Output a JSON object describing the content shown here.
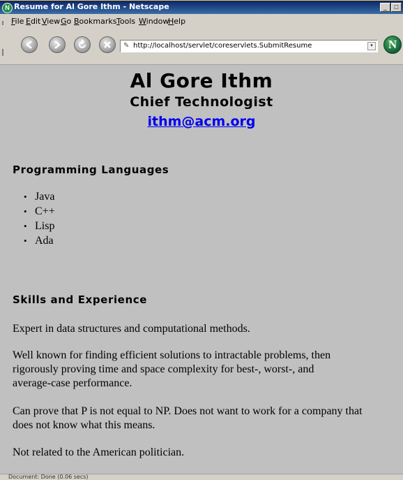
{
  "window": {
    "title": "Resume for Al Gore Ithm - Netscape",
    "app_icon_glyph": "N",
    "minimize_glyph": "_",
    "restore_glyph": "□"
  },
  "menubar": {
    "items": [
      "File",
      "Edit",
      "View",
      "Go",
      "Bookmarks",
      "Tools",
      "Window",
      "Help"
    ]
  },
  "navbar": {
    "buttons": [
      "back-icon",
      "forward-icon",
      "reload-icon",
      "stop-icon"
    ],
    "url": "http://localhost/servlet/coreservlets.SubmitResume",
    "dropdown_glyph": "▾",
    "throbber_glyph": "N"
  },
  "page": {
    "name": "Al Gore Ithm",
    "job_title": "Chief Technologist",
    "email": "ithm@acm.org",
    "sections": {
      "languages": {
        "heading": "Programming Languages",
        "items": [
          "Java",
          "C++",
          "Lisp",
          "Ada"
        ]
      },
      "skills": {
        "heading": "Skills and Experience",
        "paragraphs": [
          [
            "Expert in data structures and computational methods."
          ],
          [
            "Well known for finding efficient solutions to intractable problems, then",
            "rigorously proving time and space complexity for best-, worst-, and",
            "average-case performance."
          ],
          [
            "Can prove that P is not equal to NP. Does not want to work for a company that",
            "does not know what this means."
          ],
          [
            "Not related to the American politician."
          ]
        ]
      }
    }
  },
  "statusbar": {
    "text": "Document: Done (0.06 secs)"
  },
  "colors": {
    "page_background": "#c0c0c0",
    "link": "#0000ee",
    "titlebar": "#0a246a"
  }
}
